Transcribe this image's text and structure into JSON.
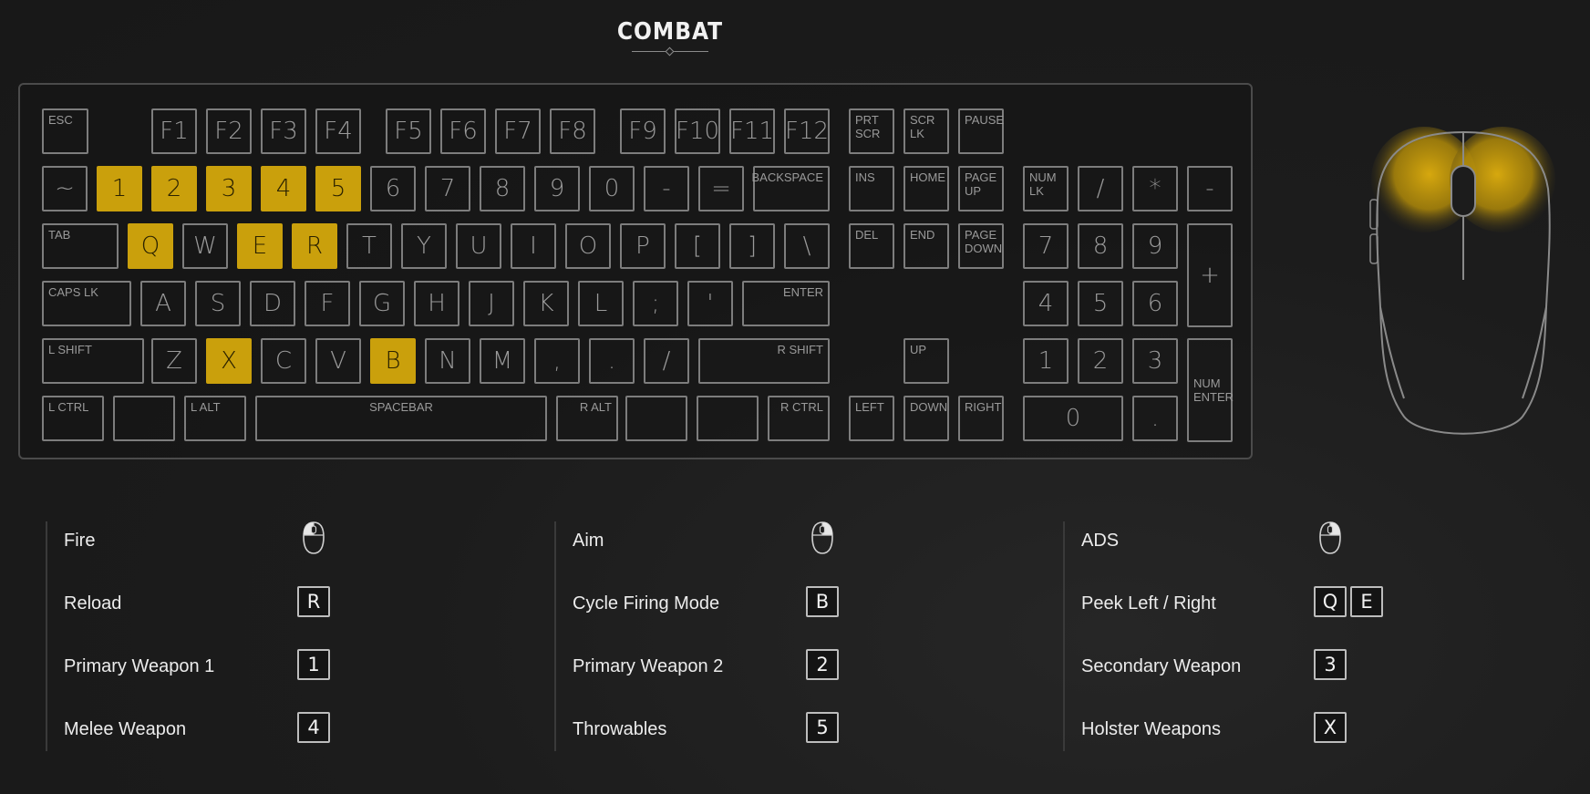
{
  "header": {
    "title": "COMBAT"
  },
  "colors": {
    "highlight": "#caa00c",
    "key_border": "#7d7d7d",
    "background": "#1c1c1c"
  },
  "keyboard": {
    "keys": [
      "ESC",
      "F1",
      "F2",
      "F3",
      "F4",
      "F5",
      "F6",
      "F7",
      "F8",
      "F9",
      "F10",
      "F11",
      "F12",
      "PRT\nSCR",
      "SCR\nLK",
      "PAUSE",
      "~",
      "1",
      "2",
      "3",
      "4",
      "5",
      "6",
      "7",
      "8",
      "9",
      "0",
      "-",
      "=",
      "BACKSPACE",
      "INS",
      "HOME",
      "PAGE\nUP",
      "NUM\nLK",
      "/",
      "*",
      "-",
      "TAB",
      "Q",
      "W",
      "E",
      "R",
      "T",
      "Y",
      "U",
      "I",
      "O",
      "P",
      "[",
      "]",
      "\\",
      "DEL",
      "END",
      "PAGE\nDOWN",
      "7",
      "8",
      "9",
      "+",
      "CAPS LK",
      "A",
      "S",
      "D",
      "F",
      "G",
      "H",
      "J",
      "K",
      "L",
      ";",
      "'",
      "ENTER",
      "4",
      "5",
      "6",
      "L SHIFT",
      "Z",
      "X",
      "C",
      "V",
      "B",
      "N",
      "M",
      ",",
      ".",
      "/",
      "R SHIFT",
      "UP",
      "1",
      "2",
      "3",
      "NUM\nENTER",
      "L CTRL",
      "",
      "L ALT",
      "SPACEBAR",
      "R ALT",
      "",
      "",
      "R CTRL",
      "LEFT",
      "DOWN",
      "RIGHT",
      "0",
      "."
    ],
    "highlighted": [
      "1",
      "2",
      "3",
      "4",
      "5",
      "Q",
      "E",
      "R",
      "X",
      "B"
    ]
  },
  "mouse": {
    "highlighted_buttons": [
      "left-button",
      "right-button"
    ]
  },
  "actions": [
    [
      {
        "label": "Fire",
        "icon": "mouse-left-click-icon"
      },
      {
        "label": "Reload",
        "keys": [
          "R"
        ]
      },
      {
        "label": "Primary Weapon 1",
        "keys": [
          "1"
        ]
      },
      {
        "label": "Melee Weapon",
        "keys": [
          "4"
        ]
      }
    ],
    [
      {
        "label": "Aim",
        "icon": "mouse-right-click-icon"
      },
      {
        "label": "Cycle Firing Mode",
        "keys": [
          "B"
        ]
      },
      {
        "label": "Primary Weapon 2",
        "keys": [
          "2"
        ]
      },
      {
        "label": "Throwables",
        "keys": [
          "5"
        ]
      }
    ],
    [
      {
        "label": "ADS",
        "icon": "mouse-right-click-icon"
      },
      {
        "label": "Peek Left / Right",
        "keys": [
          "Q",
          "E"
        ]
      },
      {
        "label": "Secondary Weapon",
        "keys": [
          "3"
        ]
      },
      {
        "label": "Holster Weapons",
        "keys": [
          "X"
        ]
      }
    ]
  ]
}
